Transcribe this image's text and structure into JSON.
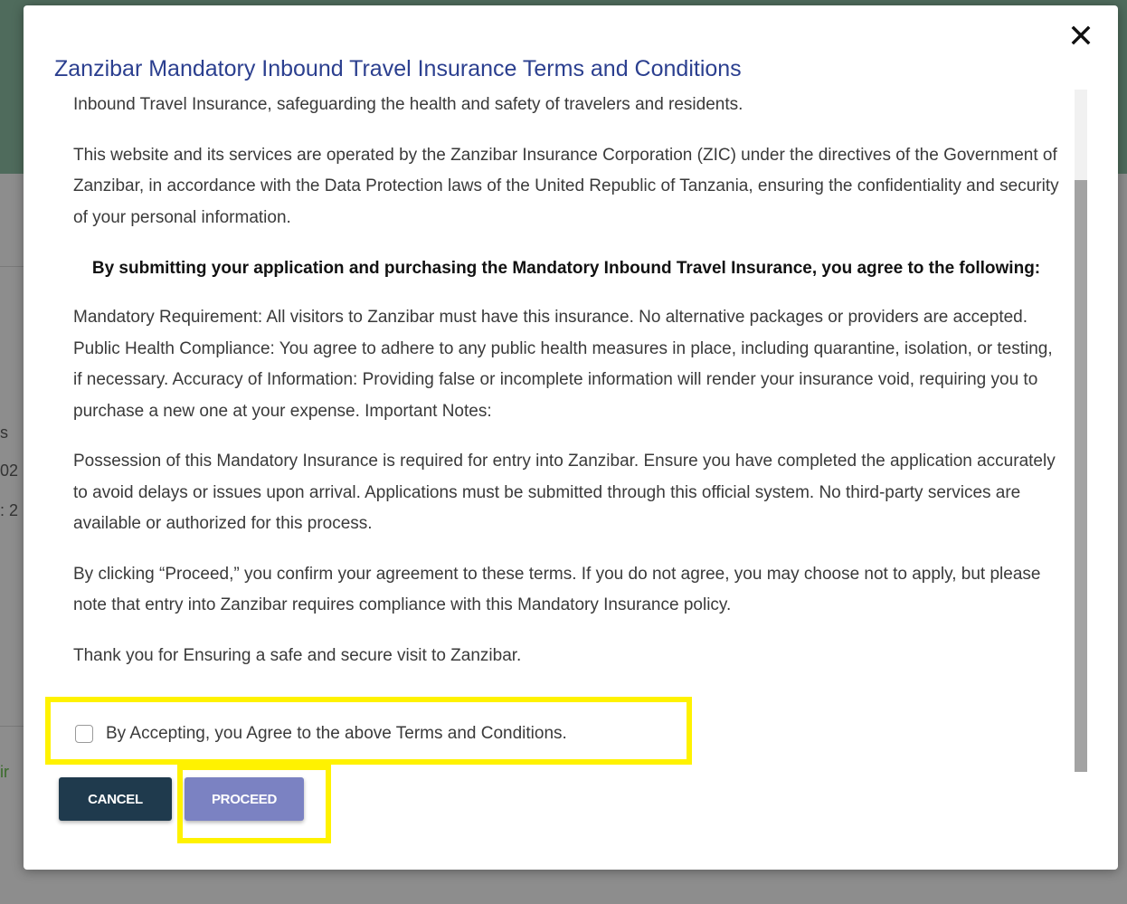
{
  "background": {
    "fragments": [
      {
        "text": "s"
      },
      {
        "text": "02"
      },
      {
        "text": ": 2"
      },
      {
        "text": "ir"
      }
    ]
  },
  "modal": {
    "title": "Zanzibar Mandatory Inbound Travel Insurance Terms and Conditions",
    "close_icon": "close-icon",
    "paragraphs": [
      "Inbound Travel Insurance, safeguarding the health and safety of travelers and residents.",
      "This website and its services are operated by the Zanzibar Insurance Corporation (ZIC) under the directives of the Government of Zanzibar, in accordance with the Data Protection laws of the United Republic of Tanzania, ensuring the confidentiality and security of your personal information.",
      "By submitting your application and purchasing the Mandatory Inbound Travel Insurance, you agree to the following:",
      "Mandatory Requirement: All visitors to Zanzibar must have this insurance. No alternative packages or providers are accepted. Public Health Compliance: You agree to adhere to any public health measures in place, including quarantine, isolation, or testing, if necessary. Accuracy of Information: Providing false or incomplete information will render your insurance void, requiring you to purchase a new one at your expense. Important Notes:",
      "Possession of this Mandatory Insurance is required for entry into Zanzibar. Ensure you have completed the application accurately to avoid delays or issues upon arrival. Applications must be submitted through this official system. No third-party services are available or authorized for this process.",
      "By clicking “Proceed,” you confirm your agreement to these terms. If you do not agree, you may choose not to apply, but please note that entry into Zanzibar requires compliance with this Mandatory Insurance policy.",
      "Thank you for Ensuring a safe and secure visit to Zanzibar."
    ],
    "accept_label": "By Accepting, you Agree to the above Terms and Conditions.",
    "accept_checked": false,
    "buttons": {
      "cancel": "CANCEL",
      "proceed": "PROCEED"
    }
  },
  "colors": {
    "title": "#2b3f8f",
    "cancel_button": "#1f3a4d",
    "proceed_button": "#7b82c2",
    "highlight": "#fff200"
  }
}
